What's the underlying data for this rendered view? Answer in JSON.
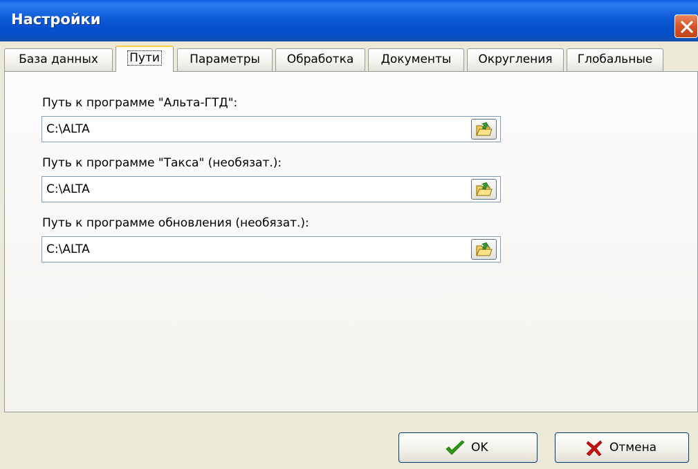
{
  "window": {
    "title": "Настройки"
  },
  "tabs": [
    {
      "label": "База данных"
    },
    {
      "label": "Пути"
    },
    {
      "label": "Параметры"
    },
    {
      "label": "Обработка"
    },
    {
      "label": "Документы"
    },
    {
      "label": "Округления"
    },
    {
      "label": "Глобальные"
    }
  ],
  "active_tab": "Пути",
  "fields": [
    {
      "label": "Путь к программе \"Альта-ГТД\":",
      "value": "C:\\ALTA"
    },
    {
      "label": "Путь к программе \"Такса\" (необязат.):",
      "value": "C:\\ALTA"
    },
    {
      "label": "Путь к программе обновления (необязат.):",
      "value": "C:\\ALTA"
    }
  ],
  "buttons": {
    "ok": "OK",
    "cancel": "Отмена"
  },
  "colors": {
    "titlebar": "#0a5ddc",
    "close": "#d5552a",
    "ok_check": "#2a9a10",
    "cancel_x": "#c81010"
  }
}
